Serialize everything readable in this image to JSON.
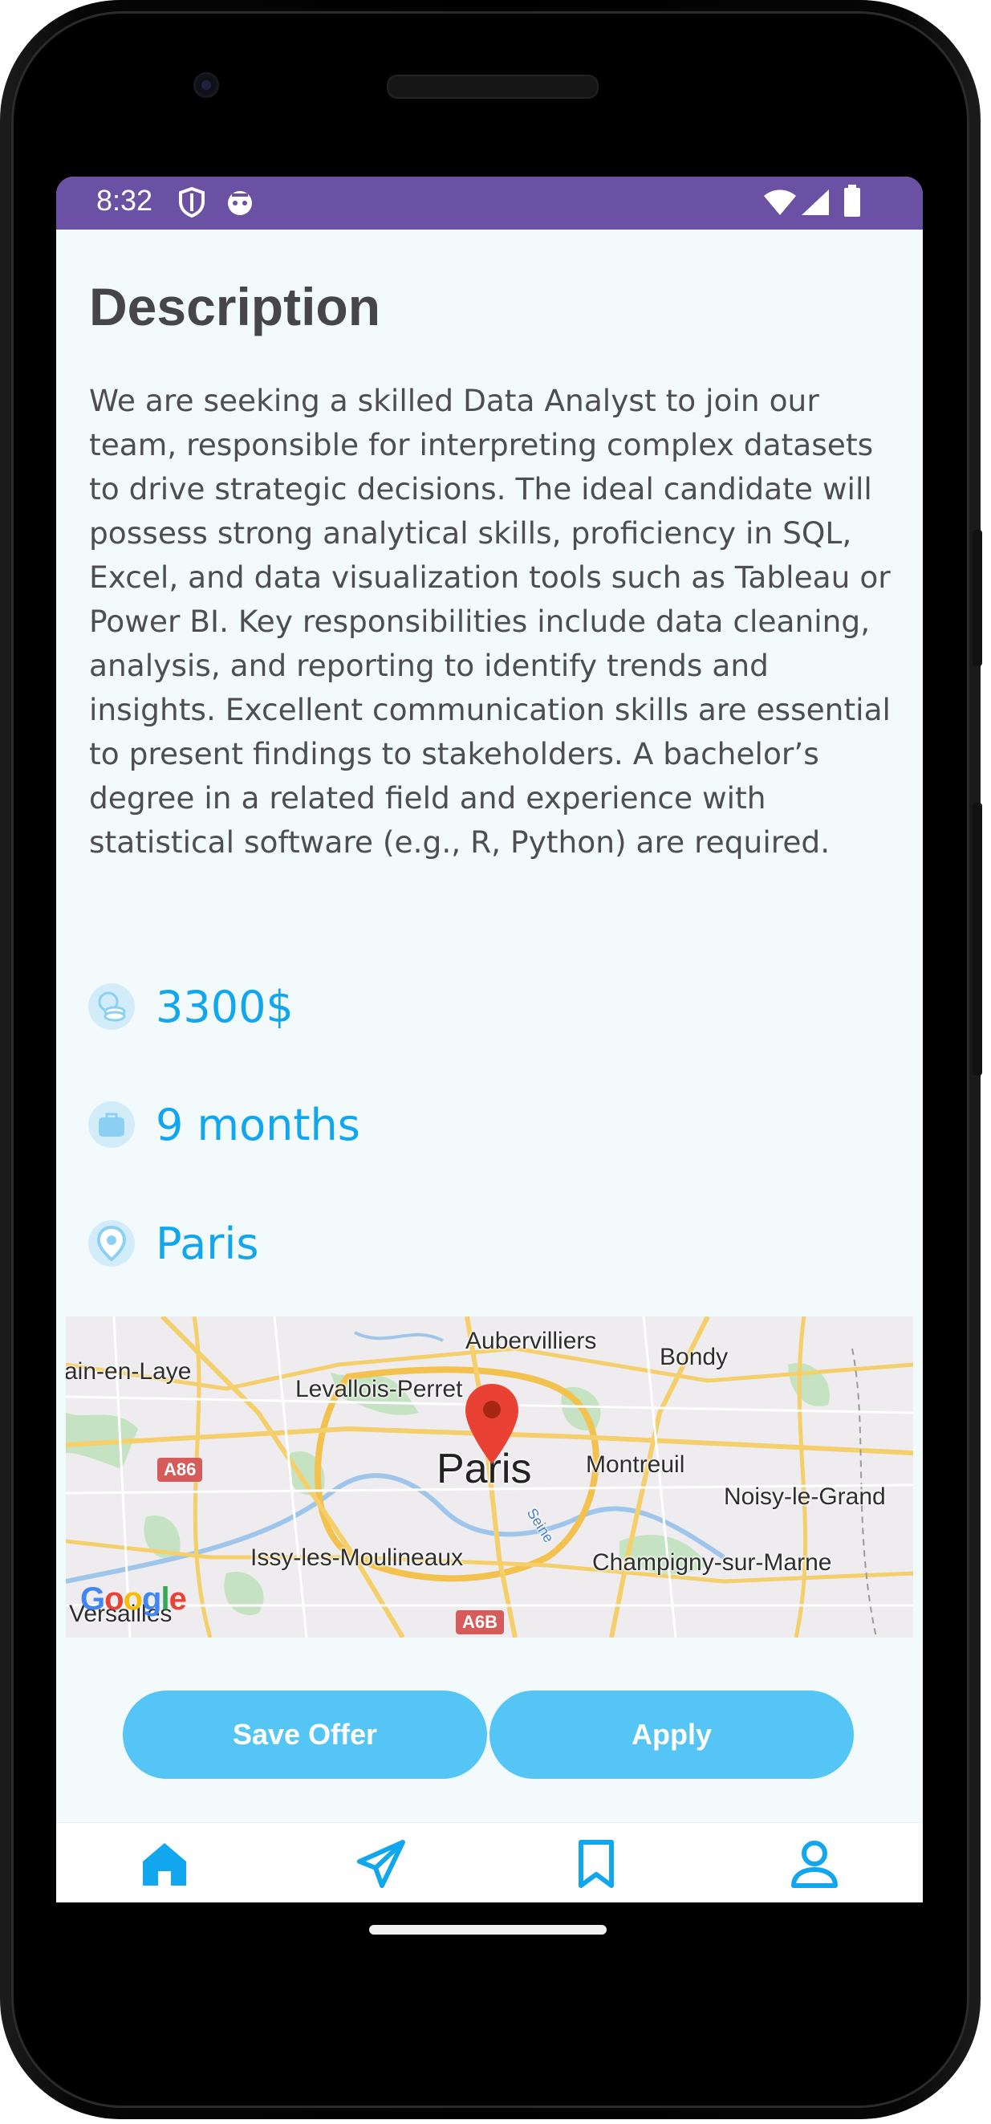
{
  "status_bar": {
    "time": "8:32",
    "icons": [
      "shield-icon",
      "android-face-icon",
      "wifi-icon",
      "signal-icon",
      "battery-icon"
    ],
    "background": "#6a51a3"
  },
  "description": {
    "title": "Description",
    "text": "We are seeking a skilled Data Analyst to join our team, responsible for interpreting complex datasets to drive strategic decisions. The ideal candidate will possess strong analytical skills, proficiency in SQL, Excel, and data visualization tools such as Tableau or Power BI. Key responsibilities include data cleaning, analysis, and reporting to identify trends and insights. Excellent communication skills are essential to present findings to stakeholders. A bachelor’s degree in a related field and experience with statistical software (e.g., R, Python) are required."
  },
  "details": {
    "salary": "3300$",
    "duration": "9 months",
    "location": "Paris",
    "accent_color": "#12a6ee"
  },
  "map": {
    "labels": {
      "aubervilliers": "Aubervilliers",
      "bondy": "Bondy",
      "saint_germain": "ain-en-Laye",
      "levallois": "Levallois-Perret",
      "paris": "Paris",
      "montreuil": "Montreuil",
      "noisy": "Noisy-le-Grand",
      "issy": "Issy-les-Moulineaux",
      "champigny": "Champigny-sur-Marne",
      "versailles": "Versailles",
      "seine": "Seine"
    },
    "road_shields": {
      "a86": "A86",
      "a6b": "A6B"
    },
    "logo": {
      "g": "G",
      "o1": "o",
      "o2": "o",
      "g2": "g",
      "l": "l",
      "e": "e"
    },
    "pin_icon": "location-pin-icon"
  },
  "actions": {
    "save_label": "Save Offer",
    "apply_label": "Apply",
    "button_color": "#55c5f6"
  },
  "bottom_nav": {
    "items": [
      "home-icon",
      "send-icon",
      "bookmark-icon",
      "profile-icon"
    ],
    "active_color": "#12a6ee"
  }
}
